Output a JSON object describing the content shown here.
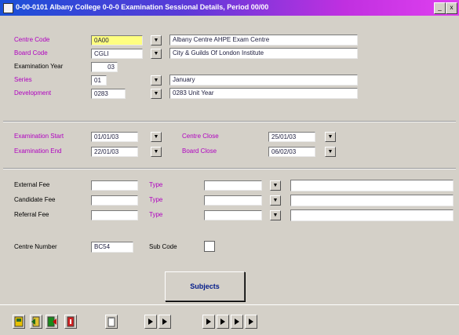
{
  "window": {
    "title": "0-00-0101 Albany College 0-0-0 Examination Sessional Details, Period 00/00",
    "min_glyph": "_",
    "close_glyph": "x"
  },
  "form": {
    "centre_code": {
      "label": "Centre Code",
      "value": "0A00",
      "description": "Albany Centre AHPE Exam Centre",
      "lov": "▼"
    },
    "board_code": {
      "label": "Board Code",
      "value": "CGLI",
      "description": "City & Guilds Of London Institute",
      "lov": "▼"
    },
    "exam_year": {
      "label": "Examination Year",
      "value": "03"
    },
    "series": {
      "label": "Series",
      "value": "01",
      "description": "January",
      "lov": "▼"
    },
    "development": {
      "label": "Development",
      "value": "0283",
      "description": "0283 Unit Year",
      "lov": "▼"
    },
    "exam_start": {
      "label": "Examination Start",
      "value": "01/01/03",
      "lov": "▼"
    },
    "exam_end": {
      "label": "Examination End",
      "value": "22/01/03",
      "lov": "▼"
    },
    "centre_close": {
      "label": "Centre Close",
      "value": "25/01/03",
      "lov": "▼"
    },
    "board_close": {
      "label": "Board Close",
      "value": "06/02/03",
      "lov": "▼"
    },
    "fees": [
      {
        "label": "External Fee",
        "type_label": "Type",
        "value": "",
        "type_value": "",
        "description": "",
        "lov": "▼"
      },
      {
        "label": "Candidate Fee",
        "type_label": "Type",
        "value": "",
        "type_value": "",
        "description": "",
        "lov": "▼"
      },
      {
        "label": "Referral Fee",
        "type_label": "Type",
        "value": "",
        "type_value": "",
        "description": "",
        "lov": "▼"
      }
    ],
    "centre_number": {
      "label": "Centre Number",
      "value": "BC54"
    },
    "sub_code": {
      "label": "Sub Code",
      "value": ""
    },
    "subjects_button": "Subjects"
  },
  "toolbar": {
    "icons": [
      "save-icon",
      "insert-record-icon",
      "exit-form-icon",
      "close-icon",
      "clipboard-icon",
      "first-record-icon",
      "previous-record-icon",
      "next-record-icon",
      "last-record-icon",
      "query-icon",
      "execute-query-icon"
    ]
  }
}
